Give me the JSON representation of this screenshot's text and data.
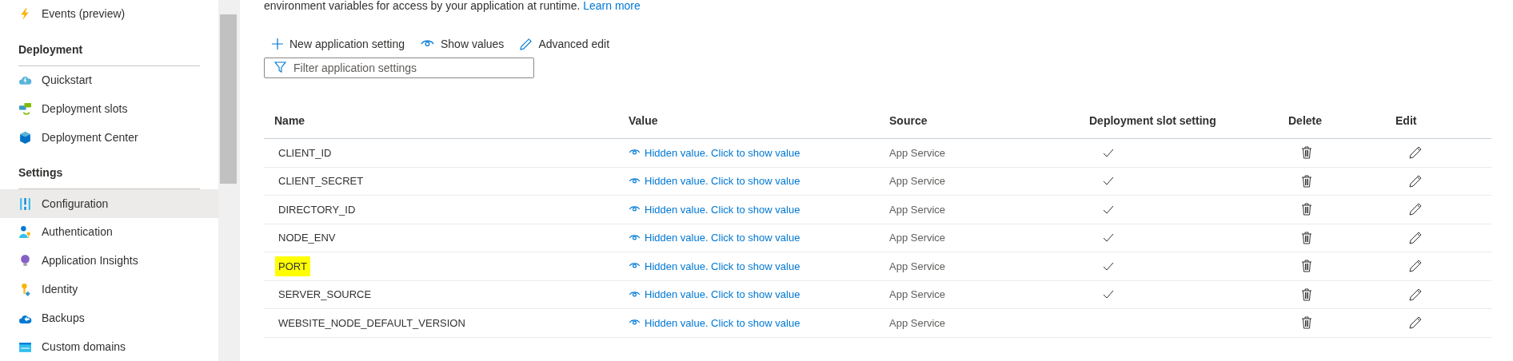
{
  "sidebar": {
    "items": [
      {
        "kind": "item",
        "label": "Events (preview)",
        "selected": false
      },
      {
        "kind": "header",
        "label": "Deployment"
      },
      {
        "kind": "item",
        "label": "Quickstart",
        "selected": false
      },
      {
        "kind": "item",
        "label": "Deployment slots",
        "selected": false
      },
      {
        "kind": "item",
        "label": "Deployment Center",
        "selected": false
      },
      {
        "kind": "header",
        "label": "Settings"
      },
      {
        "kind": "item",
        "label": "Configuration",
        "selected": true
      },
      {
        "kind": "item",
        "label": "Authentication",
        "selected": false
      },
      {
        "kind": "item",
        "label": "Application Insights",
        "selected": false
      },
      {
        "kind": "item",
        "label": "Identity",
        "selected": false
      },
      {
        "kind": "item",
        "label": "Backups",
        "selected": false
      },
      {
        "kind": "item",
        "label": "Custom domains",
        "selected": false
      }
    ]
  },
  "description": {
    "text": "environment variables for access by your application at runtime.",
    "link": "Learn more"
  },
  "toolbar": [
    {
      "label": "New application setting"
    },
    {
      "label": "Show values"
    },
    {
      "label": "Advanced edit"
    }
  ],
  "filter": {
    "placeholder": "Filter application settings"
  },
  "table": {
    "columns": [
      "Name",
      "Value",
      "Source",
      "Deployment slot setting",
      "Delete",
      "Edit"
    ],
    "rows": [
      {
        "name": "CLIENT_ID",
        "value": "Hidden value. Click to show value",
        "source": "App Service",
        "slot_setting": true,
        "highlighted": false
      },
      {
        "name": "CLIENT_SECRET",
        "value": "Hidden value. Click to show value",
        "source": "App Service",
        "slot_setting": true,
        "highlighted": false
      },
      {
        "name": "DIRECTORY_ID",
        "value": "Hidden value. Click to show value",
        "source": "App Service",
        "slot_setting": true,
        "highlighted": false
      },
      {
        "name": "NODE_ENV",
        "value": "Hidden value. Click to show value",
        "source": "App Service",
        "slot_setting": true,
        "highlighted": false
      },
      {
        "name": "PORT",
        "value": "Hidden value. Click to show value",
        "source": "App Service",
        "slot_setting": true,
        "highlighted": true
      },
      {
        "name": "SERVER_SOURCE",
        "value": "Hidden value. Click to show value",
        "source": "App Service",
        "slot_setting": true,
        "highlighted": false
      },
      {
        "name": "WEBSITE_NODE_DEFAULT_VERSION",
        "value": "Hidden value. Click to show value",
        "source": "App Service",
        "slot_setting": false,
        "highlighted": false
      }
    ]
  }
}
